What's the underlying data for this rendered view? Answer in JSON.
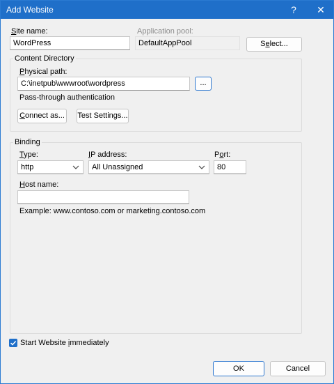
{
  "window": {
    "title": "Add Website",
    "help": "?",
    "close": "✕"
  },
  "site": {
    "label_pre": "",
    "label_key": "S",
    "label_post": "ite name:",
    "value": "WordPress"
  },
  "app_pool": {
    "label": "Application pool:",
    "value": "DefaultAppPool",
    "select_pre": "S",
    "select_key": "e",
    "select_post": "lect..."
  },
  "content": {
    "group_title": "Content Directory",
    "path_pre": "",
    "path_key": "P",
    "path_post": "hysical path:",
    "path_value": "C:\\inetpub\\wwwroot\\wordpress",
    "browse": "...",
    "auth_label": "Pass-through authentication",
    "connect_pre": "",
    "connect_key": "C",
    "connect_post": "onnect as...",
    "test_pre": "Test Settin",
    "test_key": "g",
    "test_post": "s..."
  },
  "binding": {
    "group_title": "Binding",
    "type_pre": "",
    "type_key": "T",
    "type_post": "ype:",
    "type_value": "http",
    "ip_pre": "",
    "ip_key": "I",
    "ip_post": "P address:",
    "ip_value": "All Unassigned",
    "port_pre": "P",
    "port_key": "o",
    "port_post": "rt:",
    "port_value": "80",
    "host_pre": "",
    "host_key": "H",
    "host_post": "ost name:",
    "host_value": "",
    "example": "Example: www.contoso.com or marketing.contoso.com"
  },
  "start": {
    "label_pre": "Start Website ",
    "label_key": "i",
    "label_post": "mmediately",
    "checked": true
  },
  "buttons": {
    "ok": "OK",
    "cancel": "Cancel"
  },
  "colors": {
    "titlebar": "#1f6fc9",
    "accent": "#2b76cf"
  }
}
